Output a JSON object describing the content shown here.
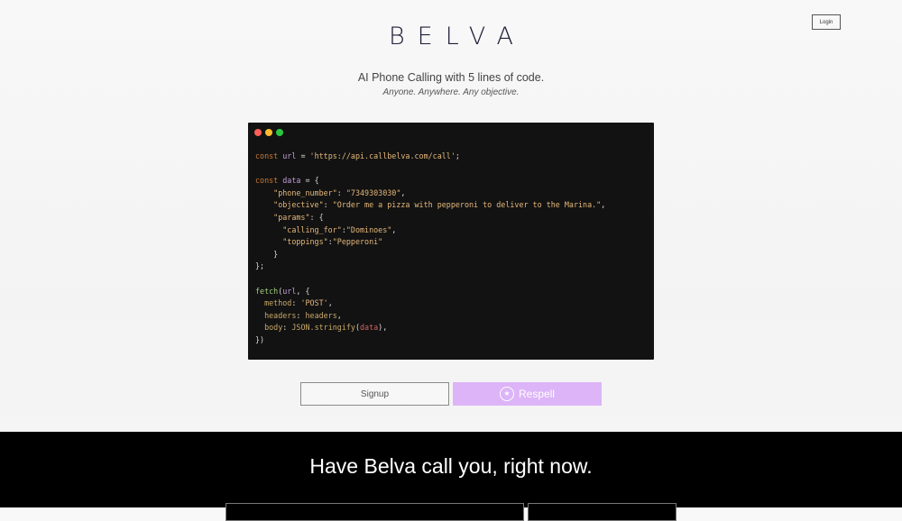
{
  "header": {
    "login_label": "Login",
    "logo": "BELVA"
  },
  "hero": {
    "tagline": "AI Phone Calling with 5 lines of code.",
    "subtagline": "Anyone. Anywhere. Any objective."
  },
  "code": {
    "const_kw": "const",
    "url_var": "url",
    "url_value": "'https://api.callbelva.com/call'",
    "data_var": "data",
    "phone_key": "\"phone_number\"",
    "phone_value": "\"7349303030\"",
    "objective_key": "\"objective\"",
    "objective_value": "\"Order me a pizza with pepperoni to deliver to the Marina.\"",
    "params_key": "\"params\"",
    "calling_for_key": "\"calling_for\"",
    "calling_for_value": "\"Dominoes\"",
    "toppings_key": "\"toppings\"",
    "toppings_value": "\"Pepperoni\"",
    "fetch_fn": "fetch",
    "method_key": "method",
    "method_value": "'POST'",
    "headers_key": "headers",
    "headers_value": "headers",
    "body_key": "body",
    "json_stringify": "JSON.stringify",
    "data_arg": "data"
  },
  "actions": {
    "signup_label": "Signup",
    "respell_label": "Respell"
  },
  "call_section": {
    "heading": "Have Belva call you, right now."
  },
  "colors": {
    "respell_bg": "#dcb4f7",
    "code_bg": "#121212",
    "band_bg": "#000000"
  }
}
